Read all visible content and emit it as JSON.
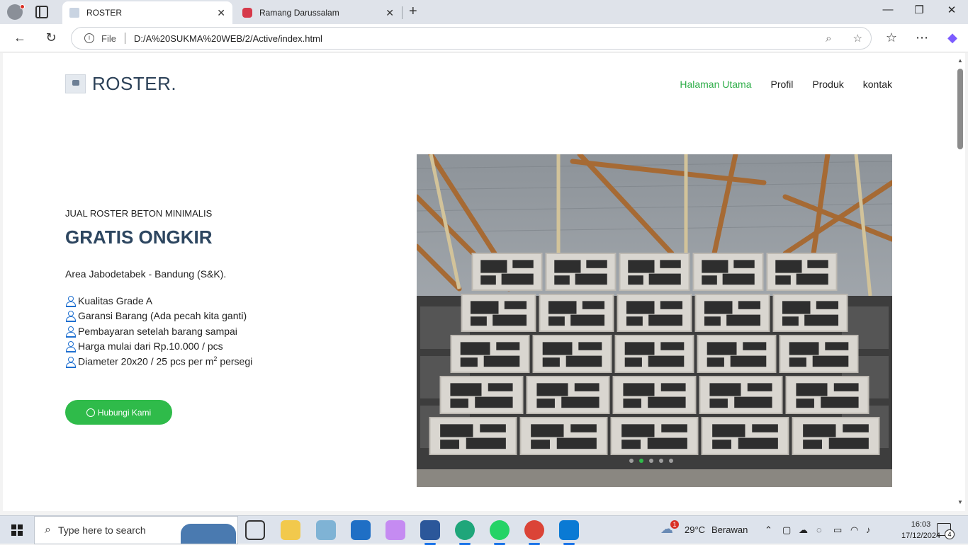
{
  "browser": {
    "tabs": [
      {
        "label": "ROSTER",
        "active": true
      },
      {
        "label": "Ramang Darussalam",
        "active": false
      }
    ],
    "address": {
      "scheme_label": "File",
      "url": "D:/A%20SUKMA%20WEB/2/Active/index.html"
    }
  },
  "site": {
    "brand": "ROSTER.",
    "nav": [
      {
        "label": "Halaman Utama",
        "active": true
      },
      {
        "label": "Profil",
        "active": false
      },
      {
        "label": "Produk",
        "active": false
      },
      {
        "label": "kontak",
        "active": false
      }
    ],
    "hero": {
      "kicker": "JUAL ROSTER BETON MINIMALIS",
      "headline": "GRATIS ONGKIR",
      "area": "Area Jabodetabek - Bandung (S&K).",
      "features": [
        "Kualitas Grade A",
        "Garansi Barang (Ada pecah kita ganti)",
        "Pembayaran setelah barang sampai",
        "Harga mulai dari Rp.10.000 / pcs"
      ],
      "feature_last": {
        "prefix": "Diameter 20x20 / 25 pcs per m",
        "sup": "2",
        "suffix": " persegi"
      },
      "cta_label": "Hubungi Kami",
      "carousel": {
        "slides": 5,
        "current": 2
      }
    },
    "accent_color": "#2fbb4a",
    "heading_color": "#2d4660"
  },
  "taskbar": {
    "search_placeholder": "Type here to search",
    "weather": {
      "temp": "29°C",
      "condition": "Berawan",
      "alert_count": "1"
    },
    "clock": {
      "time": "16:03",
      "date": "17/12/2024"
    },
    "notification_count": "4"
  }
}
